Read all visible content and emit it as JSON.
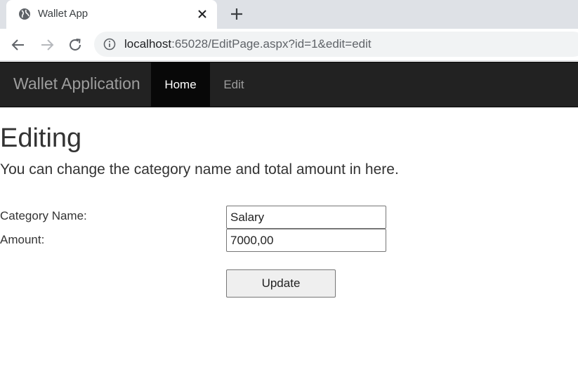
{
  "browser": {
    "tab": {
      "title": "Wallet App",
      "favicon": "globe-icon"
    },
    "url": {
      "host": "localhost",
      "rest": ":65028/EditPage.aspx?id=1&edit=edit"
    }
  },
  "navbar": {
    "brand": "Wallet Application",
    "items": [
      {
        "label": "Home",
        "active": true
      },
      {
        "label": "Edit",
        "active": false
      }
    ]
  },
  "main": {
    "title": "Editing",
    "subtitle": "You can change the category name and total amount in here.",
    "form": {
      "category_label": "Category Name:",
      "category_value": "Salary",
      "amount_label": "Amount:",
      "amount_value": "7000,00",
      "submit_label": "Update"
    }
  },
  "colors": {
    "navbar_bg": "#222222",
    "navbar_active_bg": "#080808",
    "navbar_text": "#9d9d9d",
    "body_text": "#333333"
  }
}
